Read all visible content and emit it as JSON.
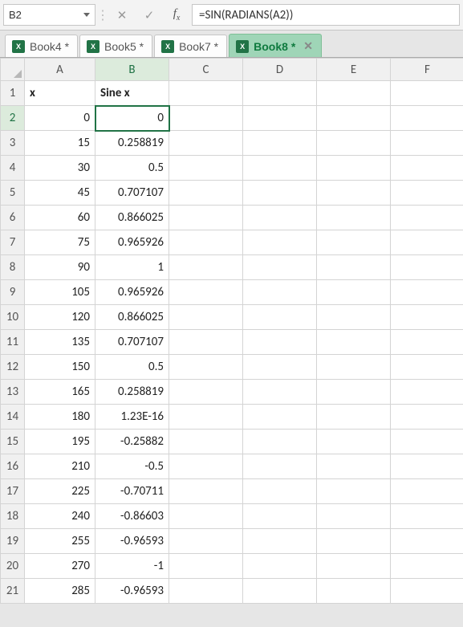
{
  "nameBox": {
    "value": "B2"
  },
  "formulaBar": {
    "formula": "=SIN(RADIANS(A2))"
  },
  "fbButtons": {
    "cancel": "✕",
    "confirm": "✓",
    "fx_f": "f",
    "fx_x": "x"
  },
  "workbookTabs": [
    {
      "label": "Book4 *",
      "active": false
    },
    {
      "label": "Book5 *",
      "active": false
    },
    {
      "label": "Book7 *",
      "active": false
    },
    {
      "label": "Book8 *",
      "active": true
    }
  ],
  "tabClose": "✕",
  "colHeaders": [
    "A",
    "B",
    "C",
    "D",
    "E",
    "F"
  ],
  "selectedCell": {
    "row": 2,
    "col": "B"
  },
  "rows": [
    {
      "n": 1,
      "A": "x",
      "B": "Sine x",
      "bold": true,
      "align": "left"
    },
    {
      "n": 2,
      "A": "0",
      "B": "0"
    },
    {
      "n": 3,
      "A": "15",
      "B": "0.258819"
    },
    {
      "n": 4,
      "A": "30",
      "B": "0.5"
    },
    {
      "n": 5,
      "A": "45",
      "B": "0.707107"
    },
    {
      "n": 6,
      "A": "60",
      "B": "0.866025"
    },
    {
      "n": 7,
      "A": "75",
      "B": "0.965926"
    },
    {
      "n": 8,
      "A": "90",
      "B": "1"
    },
    {
      "n": 9,
      "A": "105",
      "B": "0.965926"
    },
    {
      "n": 10,
      "A": "120",
      "B": "0.866025"
    },
    {
      "n": 11,
      "A": "135",
      "B": "0.707107"
    },
    {
      "n": 12,
      "A": "150",
      "B": "0.5"
    },
    {
      "n": 13,
      "A": "165",
      "B": "0.258819"
    },
    {
      "n": 14,
      "A": "180",
      "B": "1.23E-16"
    },
    {
      "n": 15,
      "A": "195",
      "B": "-0.25882"
    },
    {
      "n": 16,
      "A": "210",
      "B": "-0.5"
    },
    {
      "n": 17,
      "A": "225",
      "B": "-0.70711"
    },
    {
      "n": 18,
      "A": "240",
      "B": "-0.86603"
    },
    {
      "n": 19,
      "A": "255",
      "B": "-0.96593"
    },
    {
      "n": 20,
      "A": "270",
      "B": "-1"
    },
    {
      "n": 21,
      "A": "285",
      "B": "-0.96593"
    }
  ]
}
